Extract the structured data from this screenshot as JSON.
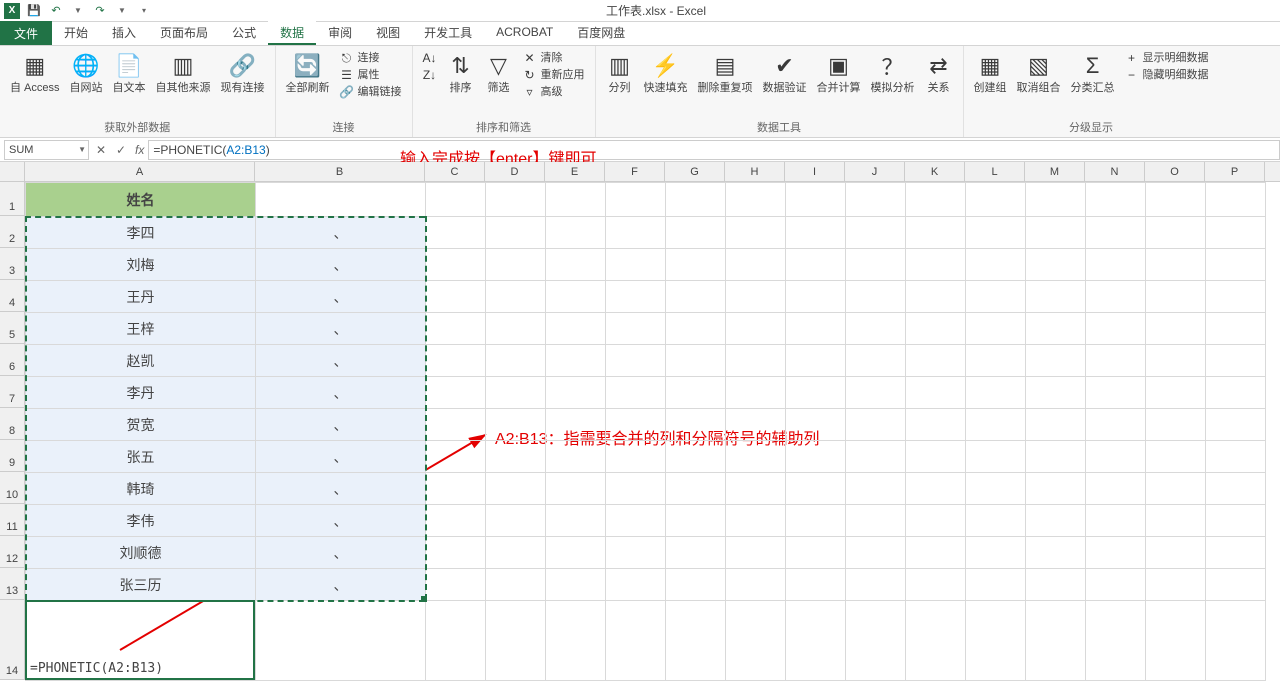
{
  "window": {
    "title": "工作表.xlsx - Excel"
  },
  "qat": {
    "save": "💾",
    "undo": "↶",
    "redo": "↷",
    "excel": "X"
  },
  "tabs": {
    "file": "文件",
    "home": "开始",
    "insert": "插入",
    "pagelayout": "页面布局",
    "formulas": "公式",
    "data": "数据",
    "review": "审阅",
    "view": "视图",
    "dev": "开发工具",
    "acrobat": "ACROBAT",
    "baidu": "百度网盘"
  },
  "ribbon": {
    "ext": {
      "access": "自 Access",
      "web": "自网站",
      "text": "自文本",
      "other": "自其他来源",
      "existing": "现有连接",
      "label": "获取外部数据"
    },
    "conn": {
      "refresh": "全部刷新",
      "connections": "连接",
      "properties": "属性",
      "editlinks": "编辑链接",
      "label": "连接"
    },
    "sort": {
      "az": "A→Z",
      "za": "Z→A",
      "sort": "排序",
      "filter": "筛选",
      "clear": "清除",
      "reapply": "重新应用",
      "advanced": "高级",
      "label": "排序和筛选"
    },
    "tools": {
      "texttocol": "分列",
      "flashfill": "快速填充",
      "removedup": "删除重复项",
      "datavalid": "数据验证",
      "consolidate": "合并计算",
      "whatif": "模拟分析",
      "relations": "关系",
      "label": "数据工具"
    },
    "outline": {
      "group": "创建组",
      "ungroup": "取消组合",
      "subtotal": "分类汇总",
      "show": "显示明细数据",
      "hide": "隐藏明细数据",
      "label": "分级显示"
    }
  },
  "namebox": "SUM",
  "formula": {
    "prefix": "=PHONETIC(",
    "range": "A2:B13",
    "suffix": ")"
  },
  "annotation1": "输入完成按【enter】键即可",
  "annotation2": "A2:B13：指需要合并的列和分隔符号的辅助列",
  "columns": [
    "A",
    "B",
    "C",
    "D",
    "E",
    "F",
    "G",
    "H",
    "I",
    "J",
    "K",
    "L",
    "M",
    "N",
    "O",
    "P"
  ],
  "rows": [
    "1",
    "2",
    "3",
    "4",
    "5",
    "6",
    "7",
    "8",
    "9",
    "10",
    "11",
    "12",
    "13",
    "14"
  ],
  "header_a": "姓名",
  "names": [
    "李四",
    "刘梅",
    "王丹",
    "王梓",
    "赵凯",
    "李丹",
    "贺宽",
    "张五",
    "韩琦",
    "李伟",
    "刘顺德",
    "张三历"
  ],
  "sep": "、",
  "a14": "=PHONETIC(A2:B13)"
}
